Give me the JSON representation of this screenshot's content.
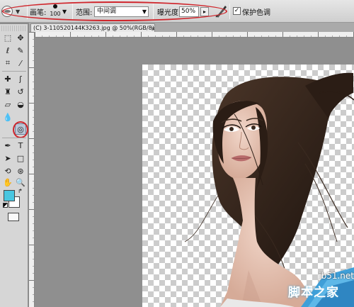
{
  "options_bar": {
    "tool_preset_icon": "sponge-tool-icon",
    "brush_label": "画笔:",
    "brush_size": "100",
    "range_label": "范围:",
    "range_value": "中间调",
    "exposure_label": "曝光度:",
    "exposure_value": "50%",
    "airbrush_icon": "airbrush-icon",
    "protect_tones_label": "保护色调",
    "protect_tones_checked": true
  },
  "document": {
    "tab_title": "(C) 3-110520144K3263.jpg @ 50%(RGB/8)",
    "tab_close": "×"
  },
  "toolbox": {
    "foreground_color": "#49c6e0",
    "background_color": "#ffffff",
    "active_tool": "sponge-tool"
  },
  "watermark": {
    "site": "jb51.net",
    "name": "脚本之家"
  },
  "colors": {
    "highlight_ring": "#d0262c",
    "toolbar_bg": "#d6d6d6"
  }
}
